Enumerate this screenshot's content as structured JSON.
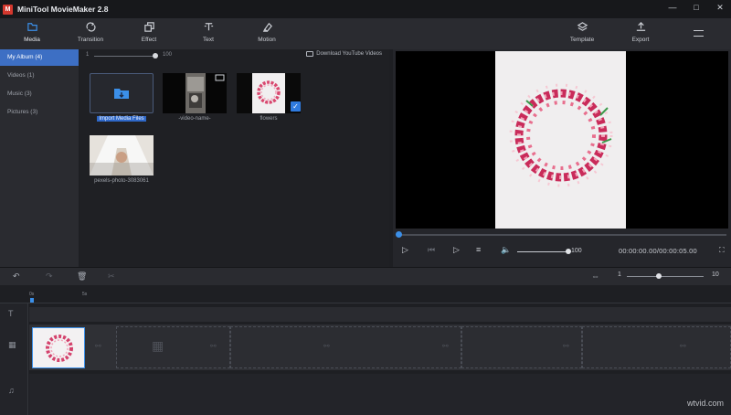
{
  "app": {
    "logo": "M",
    "title": "MiniTool MovieMaker 2.8",
    "controls": [
      "—",
      "□",
      "✕"
    ]
  },
  "toolbar": {
    "media": "Media",
    "transition": "Transition",
    "effect": "Effect",
    "text": "Text",
    "motion": "Motion",
    "template": "Template",
    "export": "Export"
  },
  "sidebar": [
    "My Album (4)",
    "Videos (1)",
    "Music (3)",
    "Pictures (3)"
  ],
  "media_panel": {
    "size_min": "1",
    "size_max": "100",
    "download_link": "Download YouTube Videos",
    "import_label": "Import Media Files",
    "clips": [
      "-video-name-",
      "flowers",
      "pexels-photo-3083061"
    ]
  },
  "preview": {
    "volume": "100",
    "timecode": "00:00:00.00/00:00:05.00"
  },
  "timeline": {
    "zoom_min": "1",
    "zoom_max": "10",
    "ticks": [
      "0s",
      "5s"
    ]
  },
  "watermark": "wtvid.com",
  "colors": {
    "accent": "#3b8fe8",
    "selection": "#3d6fc4",
    "logo": "#d4382e"
  }
}
